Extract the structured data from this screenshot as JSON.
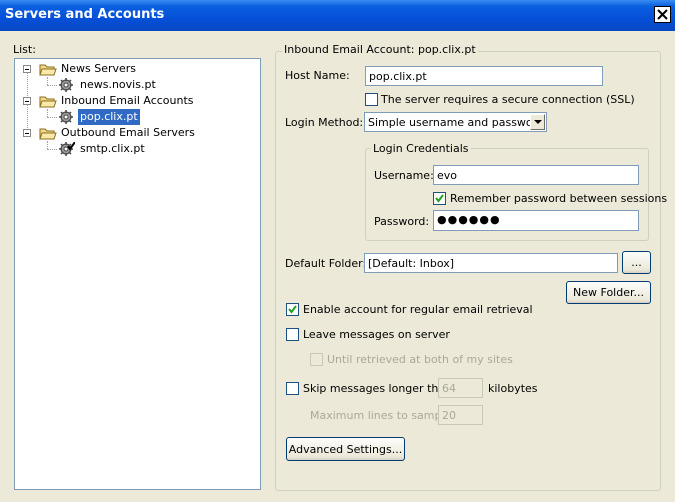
{
  "window": {
    "title": "Servers and Accounts",
    "close_glyph": "×"
  },
  "list": {
    "label": "List:",
    "items": [
      {
        "label": "News Servers",
        "type": "folder",
        "expanded": true
      },
      {
        "label": "news.novis.pt",
        "type": "server"
      },
      {
        "label": "Inbound Email Accounts",
        "type": "folder",
        "expanded": true
      },
      {
        "label": "pop.clix.pt",
        "type": "server",
        "selected": true
      },
      {
        "label": "Outbound Email Servers",
        "type": "folder",
        "expanded": true
      },
      {
        "label": "smtp.clix.pt",
        "type": "server-default"
      }
    ]
  },
  "account": {
    "group_title": "Inbound Email Account: pop.clix.pt",
    "host_name_label": "Host Name:",
    "host_name_value": "pop.clix.pt",
    "ssl_label": "The server requires a secure connection (SSL)",
    "ssl_checked": false,
    "login_method_label": "Login Method:",
    "login_method_value": "Simple username and password",
    "credentials": {
      "title": "Login Credentials",
      "username_label": "Username:",
      "username_value": "evo",
      "remember_label": "Remember password between sessions",
      "remember_checked": true,
      "password_label": "Password:",
      "password_value": "●●●●●●"
    },
    "default_folder_label": "Default Folder:",
    "default_folder_value": "[Default: Inbox]",
    "browse_label": "...",
    "new_folder_label": "New Folder...",
    "enable_label": "Enable account for regular email retrieval",
    "enable_checked": true,
    "leave_label": "Leave messages on server",
    "leave_checked": false,
    "until_label": "Until retrieved at both of my sites",
    "until_checked": false,
    "skip_label": "Skip messages longer than",
    "skip_checked": false,
    "skip_value": "64",
    "kilobytes_label": "kilobytes",
    "max_lines_label": "Maximum lines to sample:",
    "max_lines_value": "20",
    "advanced_label": "Advanced Settings..."
  },
  "colors": {
    "titlebar": "#0550d8",
    "selection": "#316ac5",
    "window_bg": "#ece9d8"
  }
}
